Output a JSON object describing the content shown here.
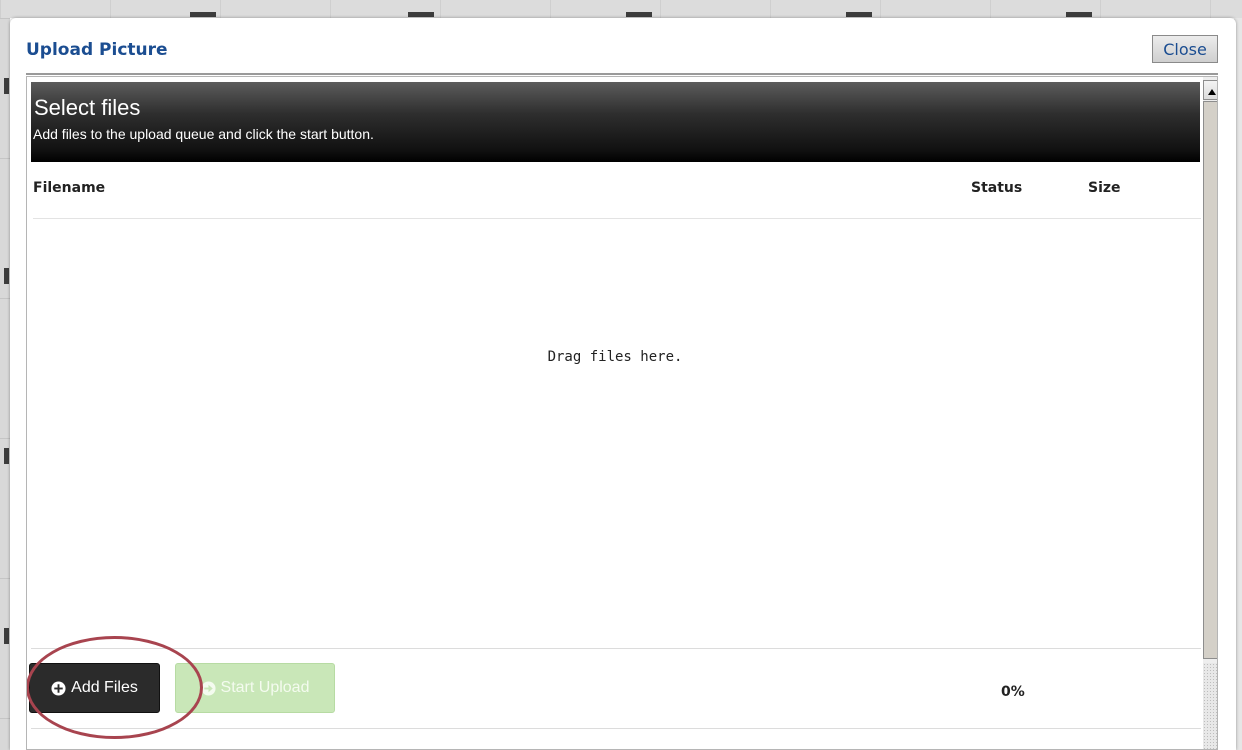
{
  "dialog": {
    "title": "Upload Picture",
    "close_label": "Close"
  },
  "uploader": {
    "header_title": "Select files",
    "header_subtitle": "Add files to the upload queue and click the start button.",
    "columns": {
      "filename": "Filename",
      "status": "Status",
      "size": "Size"
    },
    "drop_text": "Drag files here.",
    "add_files_label": "Add Files",
    "start_upload_label": "Start Upload",
    "progress_text": "0%",
    "progress_value": 0
  },
  "icons": {
    "add_files": "plus-circle-icon",
    "start_upload": "arrow-right-circle-icon",
    "scroll_up": "triangle-up-icon"
  },
  "colors": {
    "title_blue": "#1b4d91",
    "header_black": "#000000",
    "add_button": "#2b2b2b",
    "start_button_disabled": "#c9e7b8",
    "annotation_circle": "#a8444f"
  }
}
